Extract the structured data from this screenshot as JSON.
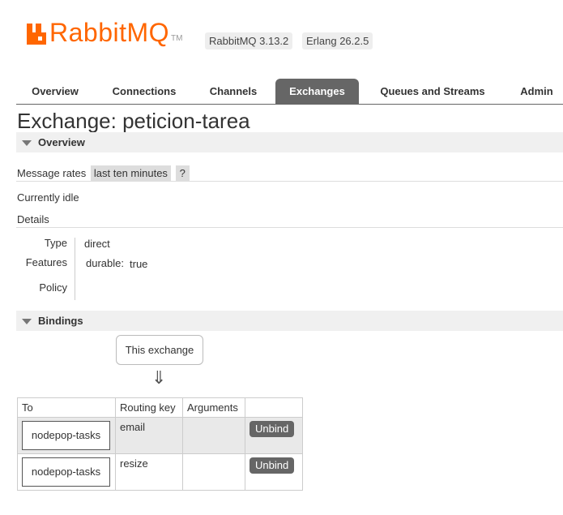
{
  "header": {
    "brand": "RabbitMQ",
    "tm": "TM",
    "version_rabbitmq": "RabbitMQ 3.13.2",
    "version_erlang": "Erlang 26.2.5",
    "brand_color": "#ff6600"
  },
  "tabs": [
    {
      "label": "Overview",
      "active": false
    },
    {
      "label": "Connections",
      "active": false
    },
    {
      "label": "Channels",
      "active": false
    },
    {
      "label": "Exchanges",
      "active": true
    },
    {
      "label": "Queues and Streams",
      "active": false
    },
    {
      "label": "Admin",
      "active": false
    }
  ],
  "page": {
    "title": "Exchange: peticion-tarea"
  },
  "overview": {
    "header": "Overview",
    "message_rates_label": "Message rates",
    "message_rates_value": "last ten minutes",
    "help": "?",
    "status": "Currently idle",
    "details_label": "Details",
    "details": {
      "type_key": "Type",
      "type_value": "direct",
      "features_key": "Features",
      "features_name": "durable:",
      "features_value": "true",
      "policy_key": "Policy",
      "policy_value": ""
    }
  },
  "bindings": {
    "header": "Bindings",
    "source_label": "This exchange",
    "arrow": "⇓",
    "columns": [
      "To",
      "Routing key",
      "Arguments",
      ""
    ],
    "rows": [
      {
        "to": "nodepop-tasks",
        "routing_key": "email",
        "arguments": "",
        "action": "Unbind"
      },
      {
        "to": "nodepop-tasks",
        "routing_key": "resize",
        "arguments": "",
        "action": "Unbind"
      }
    ]
  }
}
